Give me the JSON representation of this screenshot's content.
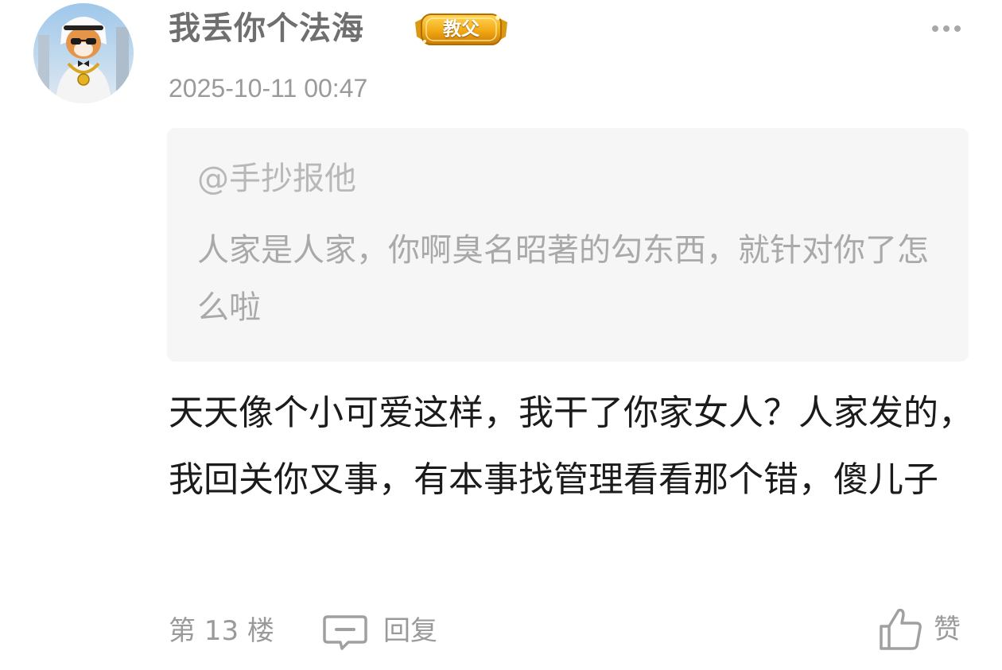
{
  "post": {
    "username": "我丢你个法海",
    "badge": "教父",
    "timestamp": "2025-10-11 00:47",
    "quote": {
      "mention": "@手抄报他",
      "text": "人家是人家，你啊臭名昭著的勾东西，就针对你了怎么啦"
    },
    "body": "天天像个小可爱这样，我干了你家女人？人家发的，我回关你叉事，有本事找管理看看那个错，傻儿子",
    "footer": {
      "floor": "第 13 楼",
      "reply_label": "回复",
      "like_label": "赞"
    }
  },
  "icons": {
    "more": "more-dots-icon",
    "reply": "comment-bubble-icon",
    "like": "thumbs-up-icon"
  },
  "colors": {
    "username": "#6f6f6f",
    "meta": "#9a9a9a",
    "quote_bg": "#f6f6f6",
    "quote_text": "#a9a9a9",
    "body_text": "#1b1b1b",
    "badge_gold": "#e8a411"
  }
}
